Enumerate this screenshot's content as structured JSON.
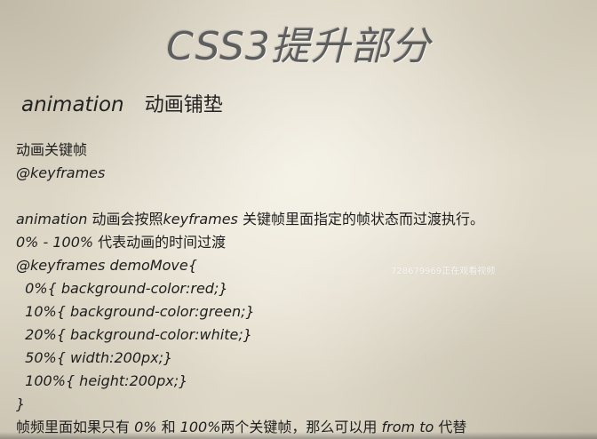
{
  "slide": {
    "title": "CSS3提升部分",
    "subtitle_keyword": "animation",
    "subtitle_text": "动画铺垫"
  },
  "body": {
    "line1": "动画关键帧",
    "line2": "@keyframes",
    "line3_kw": "animation",
    "line3_a": " 动画会按照",
    "line3_kw2": "keyframes",
    "line3_b": " 关键帧里面指定的帧状态而过渡执行。",
    "line4_kw": "0% - 100%",
    "line4_b": " 代表动画的时间过渡",
    "code": [
      "@keyframes demoMove{",
      "  0%{ background-color:red;}",
      "  10%{ background-color:green;}",
      "  20%{ background-color:white;}",
      "  50%{ width:200px;}",
      "  100%{ height:200px;}",
      "}"
    ],
    "last_a": "帧频里面如果只有 ",
    "last_kw1": "0%",
    "last_b": " 和 ",
    "last_kw2": "100%",
    "last_c": "两个关键帧，那么可以用 ",
    "last_kw3": "from to",
    "last_d": " 代替"
  },
  "watermark": "728679969正在观看视频"
}
